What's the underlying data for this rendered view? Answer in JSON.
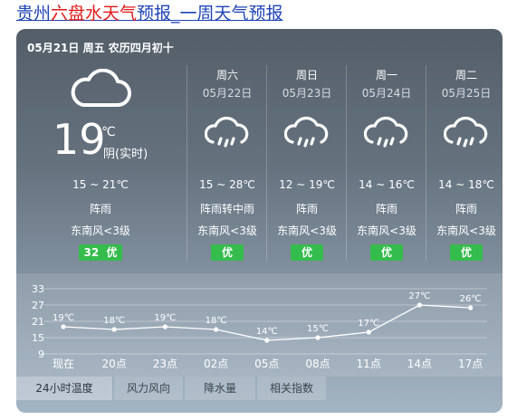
{
  "title": {
    "part1": "贵州",
    "highlight": "六盘水天气",
    "part2": "预报_一周天气预报"
  },
  "today": {
    "date_line": "05月21日 周五 农历四月初十",
    "temp": "19",
    "unit": "℃",
    "desc": "阴(实时)",
    "range": "15 ~ 21℃",
    "weather": "阵雨",
    "wind": "东南风<3级",
    "aqi_value": "32",
    "aqi_label": "优",
    "icon": "cloud-icon"
  },
  "forecast": [
    {
      "name": "周六",
      "date": "05月22日",
      "range": "15 ~ 28℃",
      "weather": "阵雨转中雨",
      "wind": "东南风<3级",
      "aqi": "优",
      "icon": "rain-cloud-icon"
    },
    {
      "name": "周日",
      "date": "05月23日",
      "range": "12 ~ 19℃",
      "weather": "阵雨",
      "wind": "东南风<3级",
      "aqi": "优",
      "icon": "rain-cloud-icon"
    },
    {
      "name": "周一",
      "date": "05月24日",
      "range": "14 ~ 16℃",
      "weather": "阵雨",
      "wind": "东南风<3级",
      "aqi": "优",
      "icon": "rain-cloud-icon"
    },
    {
      "name": "周二",
      "date": "05月25日",
      "range": "14 ~ 18℃",
      "weather": "阵雨",
      "wind": "东南风<3级",
      "aqi": "优",
      "icon": "rain-cloud-icon"
    }
  ],
  "tabs": [
    "24小时温度",
    "风力风向",
    "降水量",
    "相关指数"
  ],
  "colors": {
    "aqi_good": "#34bc4c",
    "title_link": "#1f43b8",
    "title_highlight": "#e01a1a"
  },
  "chart_data": {
    "type": "line",
    "categories": [
      "现在",
      "20点",
      "23点",
      "02点",
      "05点",
      "08点",
      "11点",
      "14点",
      "17点"
    ],
    "values": [
      19,
      18,
      19,
      18,
      14,
      15,
      17,
      27,
      26
    ],
    "data_labels": [
      "19℃",
      "18℃",
      "19℃",
      "18℃",
      "14℃",
      "15℃",
      "17℃",
      "27℃",
      "26℃"
    ],
    "yticks": [
      "33",
      "27",
      "21",
      "15",
      "9"
    ],
    "ylim": [
      9,
      33
    ],
    "grid": true,
    "title": "",
    "xlabel": "",
    "ylabel": ""
  }
}
